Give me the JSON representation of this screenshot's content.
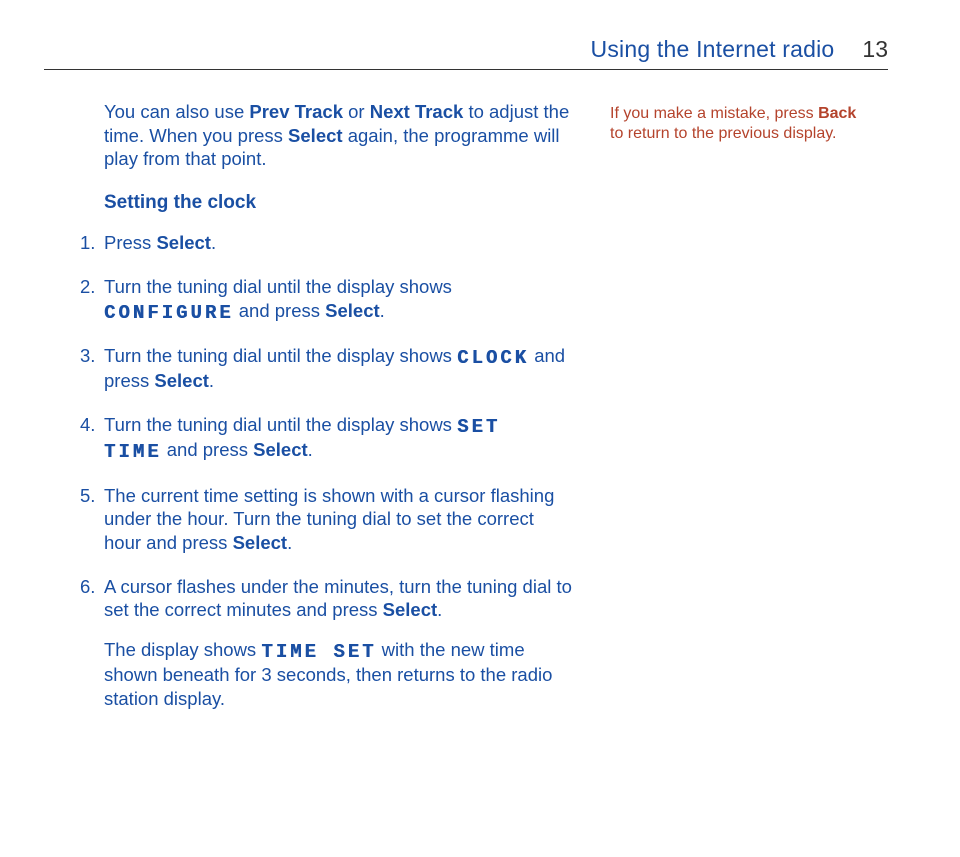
{
  "header": {
    "title": "Using the Internet radio",
    "pagenum": "13"
  },
  "intro": {
    "text_a": "You can also use ",
    "prev": "Prev Track",
    "text_b": " or ",
    "next": "Next Track",
    "text_c": " to adjust the time. When you press ",
    "select": "Select",
    "text_d": " again, the programme will play from that point."
  },
  "subhead": "Setting the clock",
  "steps": {
    "s1": {
      "a": "Press ",
      "select": "Select",
      "b": "."
    },
    "s2": {
      "a": "Turn the tuning dial until the display shows ",
      "lcd": "CONFIGURE",
      "b": " and press ",
      "select": "Select",
      "c": "."
    },
    "s3": {
      "a": "Turn the tuning dial until the display shows ",
      "lcd": "CLOCK",
      "b": " and press ",
      "select": "Select",
      "c": "."
    },
    "s4": {
      "a": "Turn the tuning dial until the display shows ",
      "lcd": "SET TIME",
      "b": " and press ",
      "select": "Select",
      "c": "."
    },
    "s5": {
      "a": "The current time setting is shown with a cursor flashing under the hour. Turn the tuning dial to set the correct hour and press ",
      "select": "Select",
      "b": "."
    },
    "s6": {
      "a": "A cursor flashes under the minutes, turn the tuning dial to set the correct minutes and press ",
      "select": "Select",
      "b": "."
    }
  },
  "outro": {
    "a": "The display shows ",
    "lcd": "TIME SET",
    "b": " with the new time shown beneath for 3 seconds, then returns to the radio station display."
  },
  "sidenote": {
    "a": "If you make a mistake, press ",
    "back": "Back",
    "b": " to return to the previous display."
  }
}
